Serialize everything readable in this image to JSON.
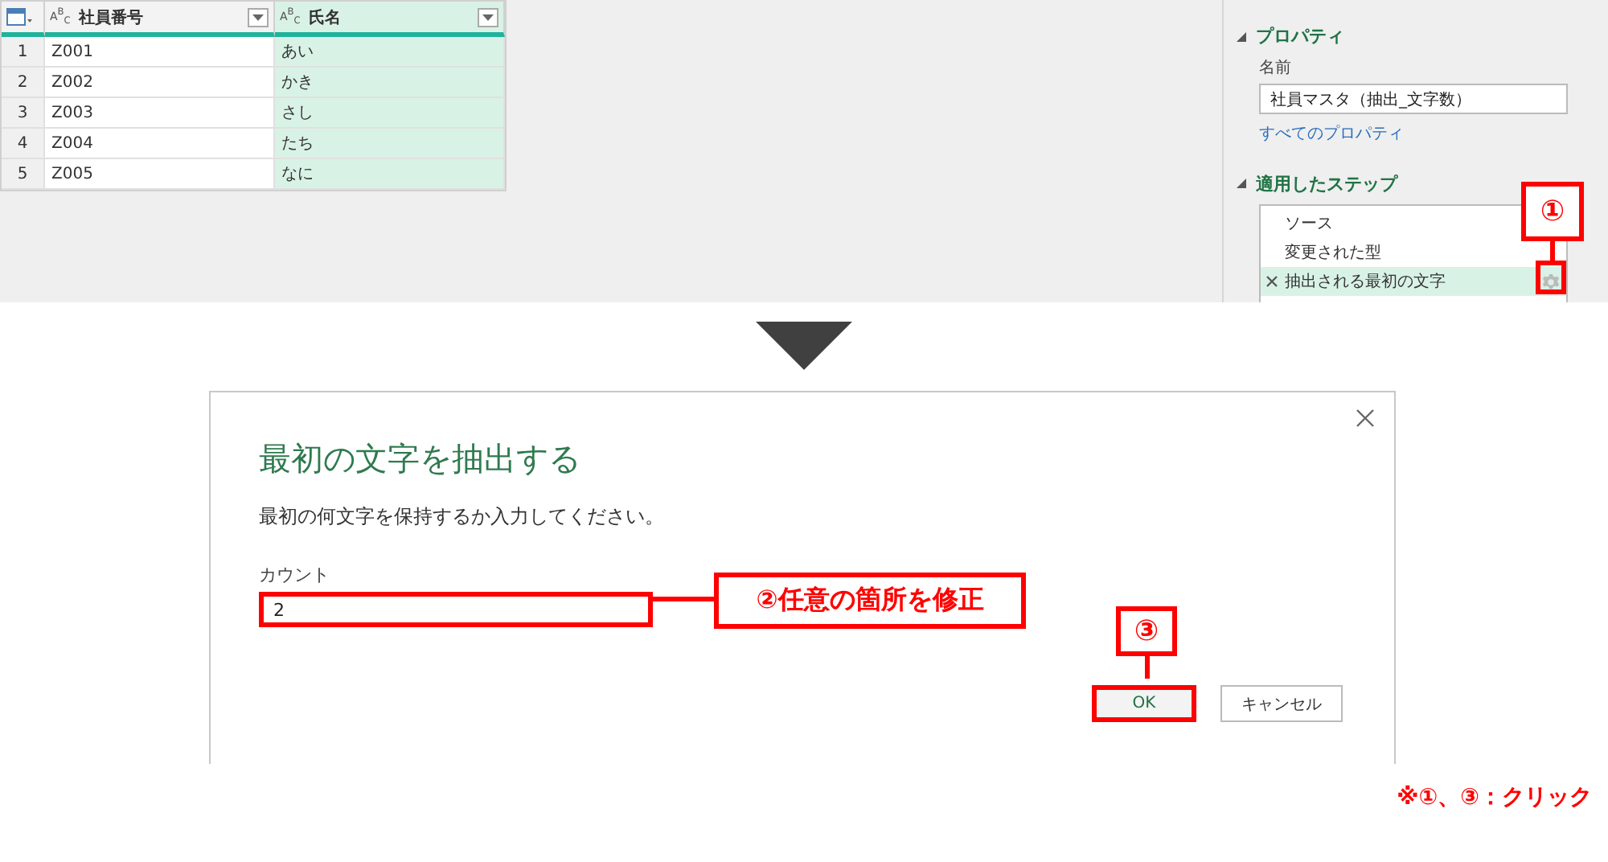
{
  "table": {
    "columns": [
      {
        "type": "A$^{B}$$_{C}$",
        "name": "社員番号",
        "selected": false
      },
      {
        "type": "A$^{B}$$_{C}$",
        "name": "氏名",
        "selected": true
      }
    ],
    "rows": [
      {
        "number": "1",
        "cells": [
          "Z001",
          "あい"
        ]
      },
      {
        "number": "2",
        "cells": [
          "Z002",
          "かき"
        ]
      },
      {
        "number": "3",
        "cells": [
          "Z003",
          "さし"
        ]
      },
      {
        "number": "4",
        "cells": [
          "Z004",
          "たち"
        ]
      },
      {
        "number": "5",
        "cells": [
          "Z005",
          "なに"
        ]
      }
    ]
  },
  "properties": {
    "heading": "プロパティ",
    "name_label": "名前",
    "name_value": "社員マスタ（抽出_文字数）",
    "all_link": "すべてのプロパティ"
  },
  "steps": {
    "heading": "適用したステップ",
    "items": [
      {
        "label": "ソース",
        "selected": false
      },
      {
        "label": "変更された型",
        "selected": false
      },
      {
        "label": "抽出される最初の文字",
        "selected": true
      }
    ]
  },
  "dialog": {
    "title": "最初の文字を抽出する",
    "description": "最初の何文字を保持するか入力してください。",
    "field_label": "カウント",
    "field_value": "2",
    "buttons": [
      {
        "label": "OK",
        "default": true
      },
      {
        "label": "キャンセル",
        "default": false
      }
    ]
  },
  "annotations": {
    "step_callout": "①",
    "field_callout": "②任意の箇所を修正",
    "ok_callout": "③",
    "note": "※①、③：クリック"
  }
}
